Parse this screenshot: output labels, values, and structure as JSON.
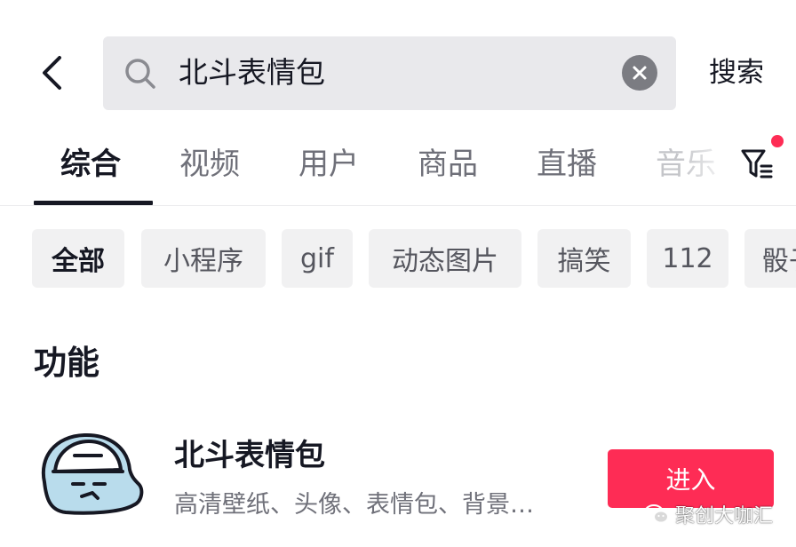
{
  "search": {
    "query": "北斗表情包",
    "submit_label": "搜索"
  },
  "tabs": [
    {
      "label": "综合",
      "active": true
    },
    {
      "label": "视频"
    },
    {
      "label": "用户"
    },
    {
      "label": "商品"
    },
    {
      "label": "直播"
    },
    {
      "label": "音乐"
    }
  ],
  "filter": {
    "has_notification": true,
    "dot_color": "#fe2c55"
  },
  "chips": [
    {
      "label": "全部",
      "active": true
    },
    {
      "label": "小程序"
    },
    {
      "label": "gif"
    },
    {
      "label": "动态图片"
    },
    {
      "label": "搞笑"
    },
    {
      "label": "112"
    },
    {
      "label": "骰子"
    }
  ],
  "section": {
    "title": "功能"
  },
  "result": {
    "name": "北斗表情包",
    "description": "高清壁纸、头像、表情包、背景…",
    "action_label": "进入",
    "action_color": "#fe2c55",
    "icon": "cartoon-face-icon"
  },
  "watermark": {
    "text": "聚创大咖汇",
    "icon": "wechat-icon"
  },
  "icons": {
    "back": "chevron-left-icon",
    "search": "search-icon",
    "clear": "clear-icon",
    "filter": "filter-icon"
  }
}
